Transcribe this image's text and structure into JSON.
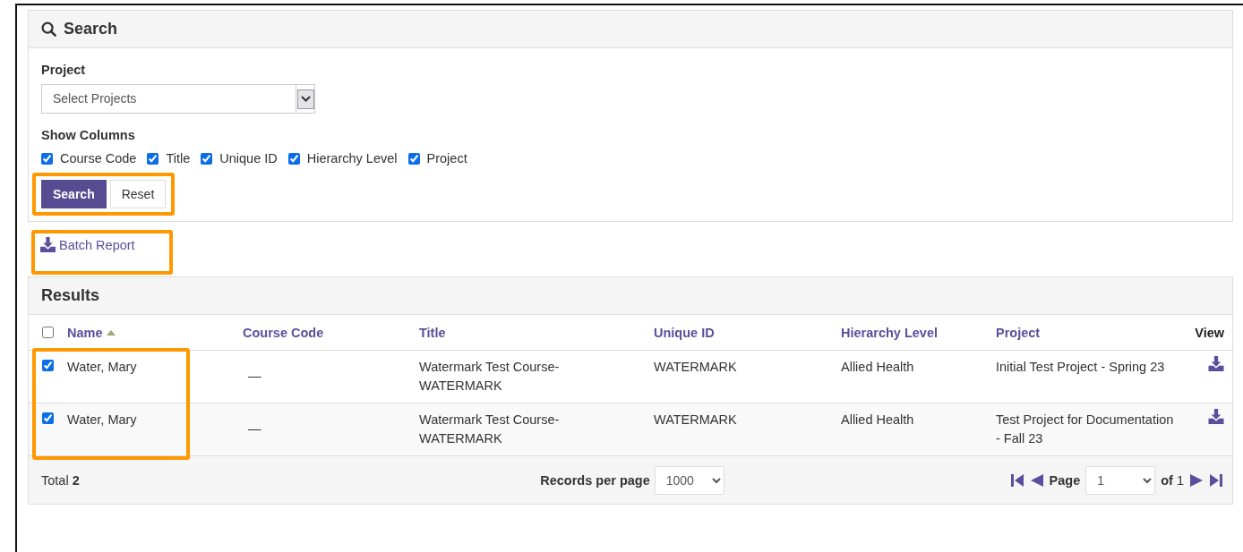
{
  "search_panel": {
    "title": "Search",
    "project_label": "Project",
    "project_select": {
      "placeholder": "Select Projects"
    },
    "show_columns_label": "Show Columns",
    "columns": [
      {
        "label": "Course Code",
        "checked": true
      },
      {
        "label": "Title",
        "checked": true
      },
      {
        "label": "Unique ID",
        "checked": true
      },
      {
        "label": "Hierarchy Level",
        "checked": true
      },
      {
        "label": "Project",
        "checked": true
      }
    ],
    "buttons": [
      {
        "label": "Search",
        "kind": "primary"
      },
      {
        "label": "Reset",
        "kind": "default"
      }
    ],
    "buttons_highlighted": true
  },
  "batch_report": {
    "label": "Batch Report",
    "highlighted": true
  },
  "results": {
    "title": "Results",
    "select_all": {
      "checked": false
    },
    "columns": [
      {
        "label": "Name",
        "kind": "sortable",
        "sorted_ascending": true
      },
      {
        "label": "Course Code",
        "kind": "sortable",
        "sorted_ascending": false
      },
      {
        "label": "Title",
        "kind": "sortable",
        "sorted_ascending": false
      },
      {
        "label": "Unique ID",
        "kind": "sortable",
        "sorted_ascending": false
      },
      {
        "label": "Hierarchy Level",
        "kind": "sortable",
        "sorted_ascending": false
      },
      {
        "label": "Project",
        "kind": "sortable",
        "sorted_ascending": false
      },
      {
        "label": "View",
        "kind": "plain",
        "sorted_ascending": false
      }
    ],
    "rows": [
      {
        "checked": true,
        "name": "Water, Mary",
        "course_code": "—",
        "title": "Watermark Test Course-WATERMARK",
        "unique_id": "WATERMARK",
        "hierarchy_level": "Allied Health",
        "project": "Initial Test Project - Spring 23"
      },
      {
        "checked": true,
        "name": "Water, Mary",
        "course_code": "—",
        "title": "Watermark Test Course-WATERMARK",
        "unique_id": "WATERMARK",
        "hierarchy_level": "Allied Health",
        "project": "Test Project for Documentation - Fall 23"
      }
    ],
    "rows_highlighted": true,
    "footer": {
      "total_label": "Total",
      "total": "2",
      "per_page_label": "Records per page",
      "per_page": "1000",
      "page_label": "Page",
      "page": "1",
      "of_label": "of",
      "page_count": "1"
    }
  }
}
